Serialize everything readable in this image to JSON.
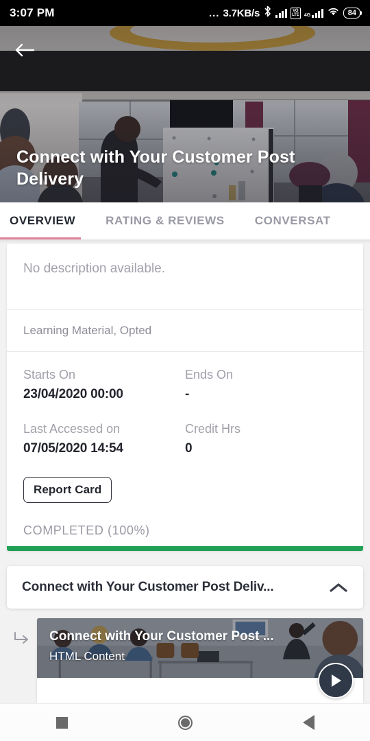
{
  "status_bar": {
    "time": "3:07 PM",
    "dots": "...",
    "network_speed": "3.7KB/s",
    "bluetooth_icon": "bluetooth-icon",
    "signal_icon": "signal-bars-icon",
    "volte_label": "VO LTE",
    "network_type": "4G",
    "wifi_icon": "wifi-icon",
    "battery_level": "84"
  },
  "hero": {
    "back_icon": "back-arrow-icon",
    "title": "Connect with Your Customer Post Delivery"
  },
  "tabs": {
    "items": [
      {
        "label": "OVERVIEW",
        "active": true
      },
      {
        "label": "RATING & REVIEWS",
        "active": false
      },
      {
        "label": "CONVERSAT",
        "active": false
      }
    ],
    "active_underline_color": "#e07f96"
  },
  "overview": {
    "description": "No description available.",
    "meta": "Learning Material, Opted",
    "fields": [
      {
        "label": "Starts On",
        "value": "23/04/2020 00:00"
      },
      {
        "label": "Ends On",
        "value": "-"
      },
      {
        "label": "Last Accessed on",
        "value": "07/05/2020 14:54"
      },
      {
        "label": "Credit Hrs",
        "value": "0"
      }
    ],
    "report_card_button": "Report Card",
    "completion_status": "COMPLETED (100%)",
    "progress_percent": 100,
    "progress_color": "#1fa055"
  },
  "module": {
    "title": "Connect with Your Customer Post Deliv...",
    "collapse_icon": "chevron-up-icon",
    "branch_icon": "subdirectory-arrow-right-icon",
    "item": {
      "title": "Connect with Your Customer Post ...",
      "type": "HTML Content",
      "play_icon": "play-icon"
    }
  },
  "nav_bar": {
    "recents_icon": "square-recents-icon",
    "home_icon": "circle-home-icon",
    "back_icon": "triangle-back-icon"
  }
}
